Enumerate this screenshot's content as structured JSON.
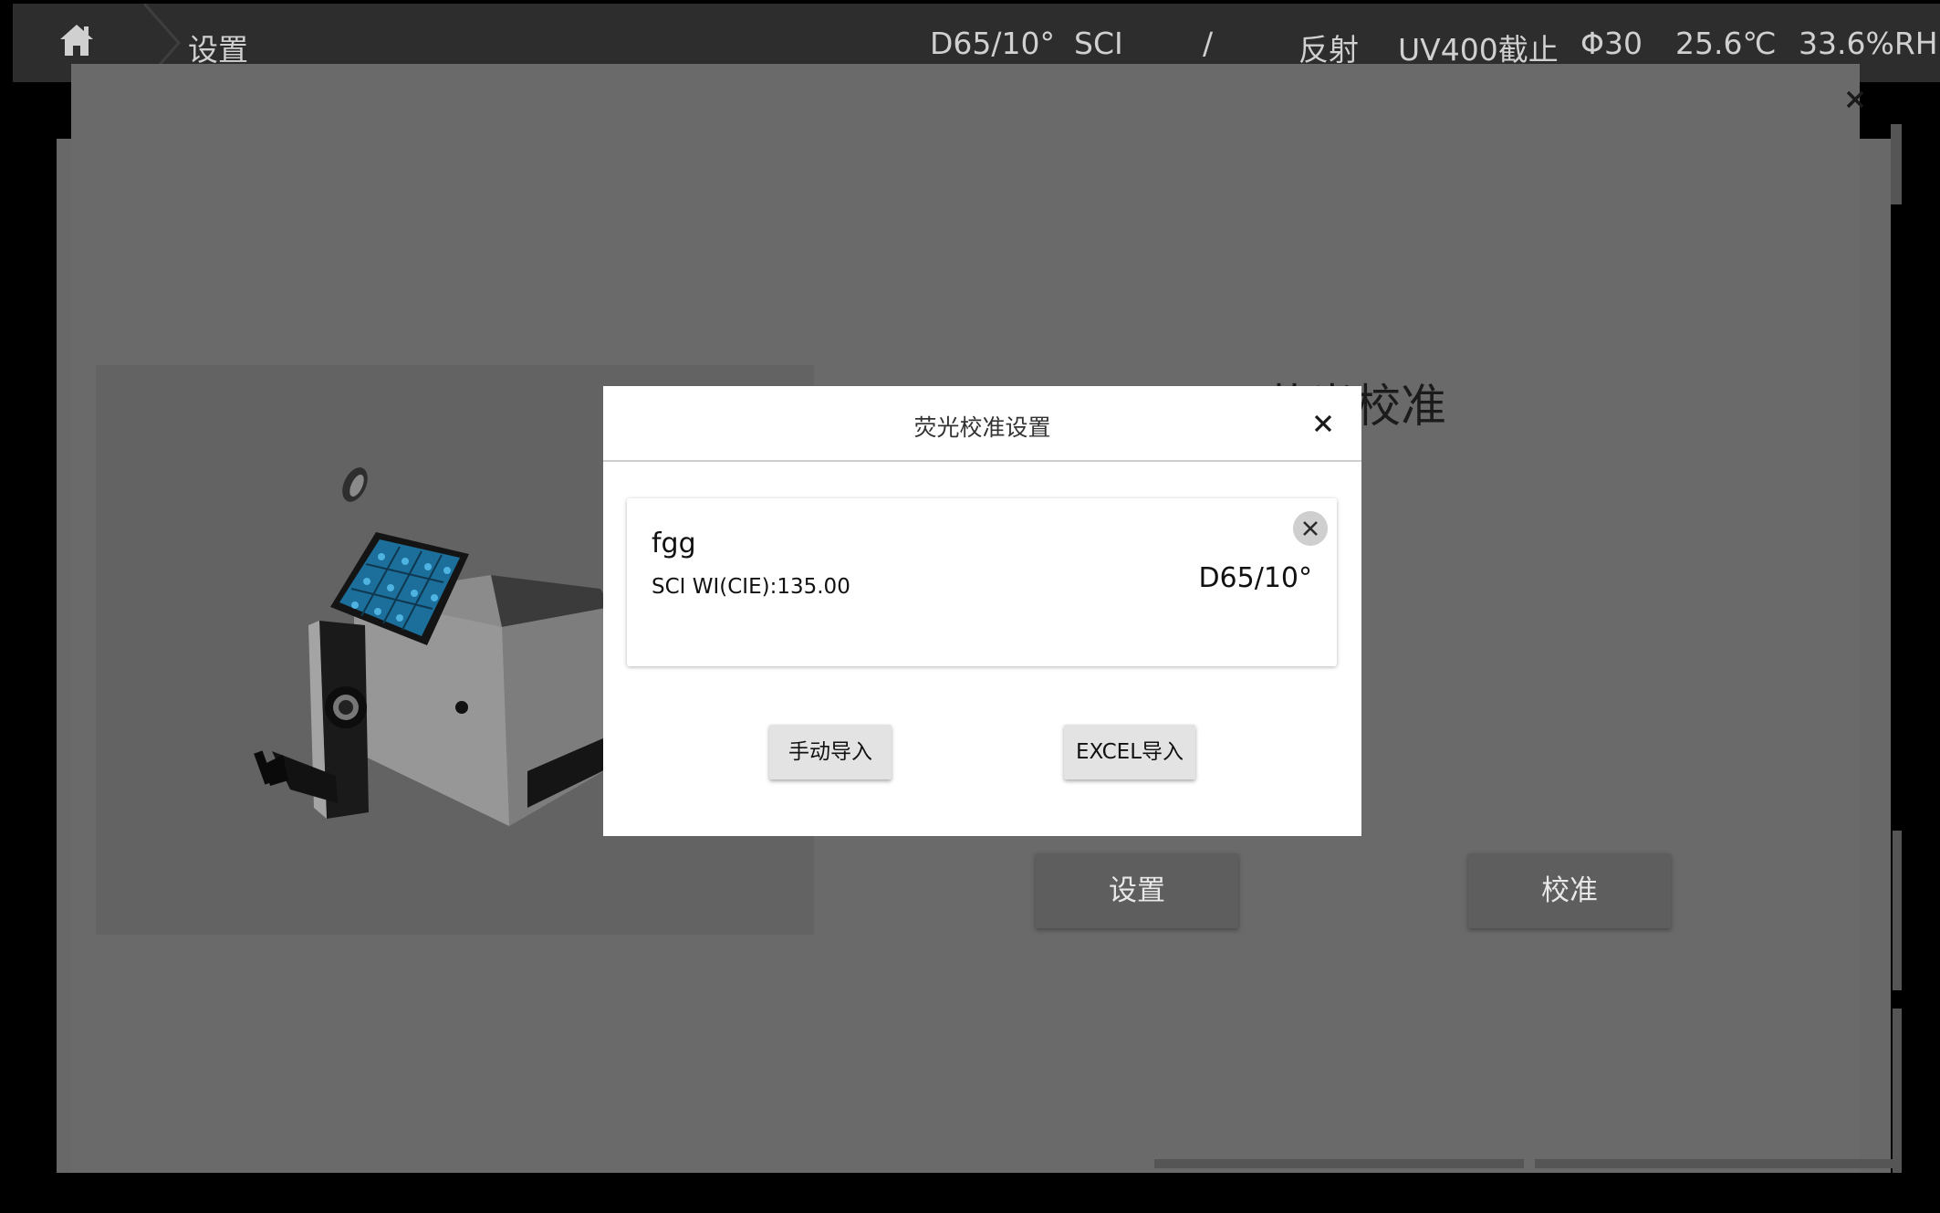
{
  "status_bar": {
    "breadcrumb": "设置",
    "items": [
      "D65/10°",
      "SCI",
      "/",
      "反射",
      "UV400截止",
      "Φ30",
      "25.6℃",
      "33.6%RH"
    ]
  },
  "background_page": {
    "heading": "荧光校准",
    "buttons": {
      "settings": "设置",
      "calibrate": "校准"
    }
  },
  "modal": {
    "title": "荧光校准设置",
    "card": {
      "name": "fgg",
      "wi": "SCI WI(CIE):135.00",
      "illuminant": "D65/10°"
    },
    "buttons": {
      "manual_import": "手动导入",
      "excel_import": "EXCEL导入"
    }
  },
  "colors": {
    "topbar": "#2d2d2d",
    "overlay": "#6a6a6a",
    "modal": "#ffffff",
    "button": "#e3e3e3",
    "device_screen": "#1e8fc8"
  }
}
